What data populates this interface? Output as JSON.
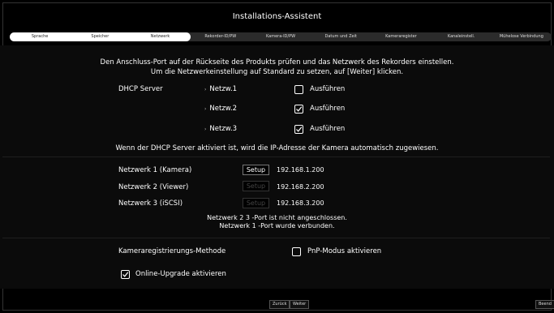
{
  "title": "Installations-Assistent",
  "steps": [
    "Sprache",
    "Speicher",
    "Netzwerk",
    "Rekorder-ID/PW",
    "Kamera-ID/PW",
    "Datum und Zeit",
    "Kameraregister",
    "Kanaleinstell.",
    "Mühelose Verbindung"
  ],
  "intro_line1": "Den Anschluss-Port auf der Rückseite des Produkts prüfen und das Netzwerk des Rekorders einstellen.",
  "intro_line2": "Um die Netzwerkeinstellung auf Standard zu setzen, auf [Weiter] klicken.",
  "dhcp": {
    "label": "DHCP Server",
    "rows": [
      {
        "name": "Netzw.1",
        "option": "Ausführen",
        "checked": false
      },
      {
        "name": "Netzw.2",
        "option": "Ausführen",
        "checked": true
      },
      {
        "name": "Netzw.3",
        "option": "Ausführen",
        "checked": true
      }
    ],
    "note": "Wenn der DHCP Server aktiviert ist, wird die IP-Adresse der Kamera automatisch zugewiesen."
  },
  "networks": [
    {
      "label": "Netzwerk 1 (Kamera)",
      "button": "Setup",
      "ip": "192.168.1.200",
      "enabled": true
    },
    {
      "label": "Netzwerk 2 (Viewer)",
      "button": "Setup",
      "ip": "192.168.2.200",
      "enabled": false
    },
    {
      "label": "Netzwerk 3 (iSCSI)",
      "button": "Setup",
      "ip": "192.168.3.200",
      "enabled": false
    }
  ],
  "port_note_line1": "Netzwerk 2 3 -Port ist nicht angeschlossen.",
  "port_note_line2": "Netzwerk 1 -Port wurde verbunden.",
  "camreg": {
    "label": "Kameraregistrierungs-Methode",
    "option": "PnP-Modus aktivieren",
    "checked": false
  },
  "upgrade": {
    "label": "Online-Upgrade aktivieren",
    "checked": true
  },
  "footer": {
    "back": "Zurück",
    "next": "Weiter",
    "finish": "Beend"
  }
}
